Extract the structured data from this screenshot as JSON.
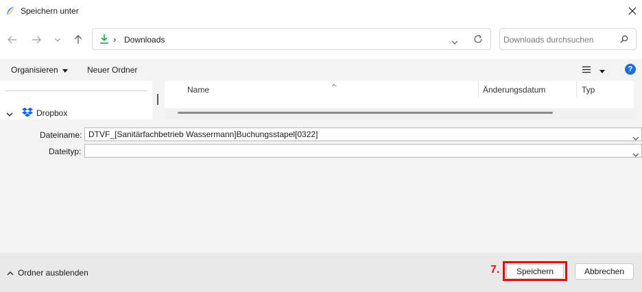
{
  "window": {
    "title": "Speichern unter",
    "app_icon": "feather-logo-icon",
    "close_icon": "close-icon"
  },
  "nav": {
    "back_icon": "arrow-left-icon",
    "forward_icon": "arrow-right-icon",
    "recent_icon": "chevron-down-icon",
    "up_icon": "arrow-up-icon",
    "address": {
      "icon": "download-icon",
      "separator": "›",
      "location": "Downloads",
      "dropdown_icon": "chevron-down-icon",
      "refresh_icon": "refresh-icon"
    },
    "search": {
      "placeholder": "Downloads durchsuchen",
      "value": "",
      "icon": "search-icon"
    }
  },
  "toolbar": {
    "organize_label": "Organisieren",
    "new_folder_label": "Neuer Ordner",
    "view_icon": "list-view-icon",
    "help_icon": "help-icon",
    "help_glyph": "?"
  },
  "navpane": {
    "items": [
      {
        "label": "Dropbox",
        "icon": "dropbox-icon",
        "expander_icon": "chevron-down-icon"
      }
    ]
  },
  "filelist": {
    "columns": [
      {
        "label": "Name"
      },
      {
        "label": "Änderungsdatum"
      },
      {
        "label": "Typ"
      }
    ]
  },
  "fields": {
    "filename_label": "Dateiname:",
    "filename_value": "DTVF_[Sanitärfachbetrieb Wassermann]Buchungsstapel[0322]",
    "filetype_label": "Dateityp:",
    "filetype_value": ""
  },
  "footer": {
    "hide_folders_label": "Ordner ausblenden",
    "hide_icon": "chevron-up-icon",
    "step_annotation": "7.",
    "save_label": "Speichern",
    "cancel_label": "Abbrechen"
  },
  "colors": {
    "accent": "#0067c0",
    "download_green": "#16a34a",
    "dropbox_blue": "#0061fe",
    "annotation_red": "#e01010"
  }
}
